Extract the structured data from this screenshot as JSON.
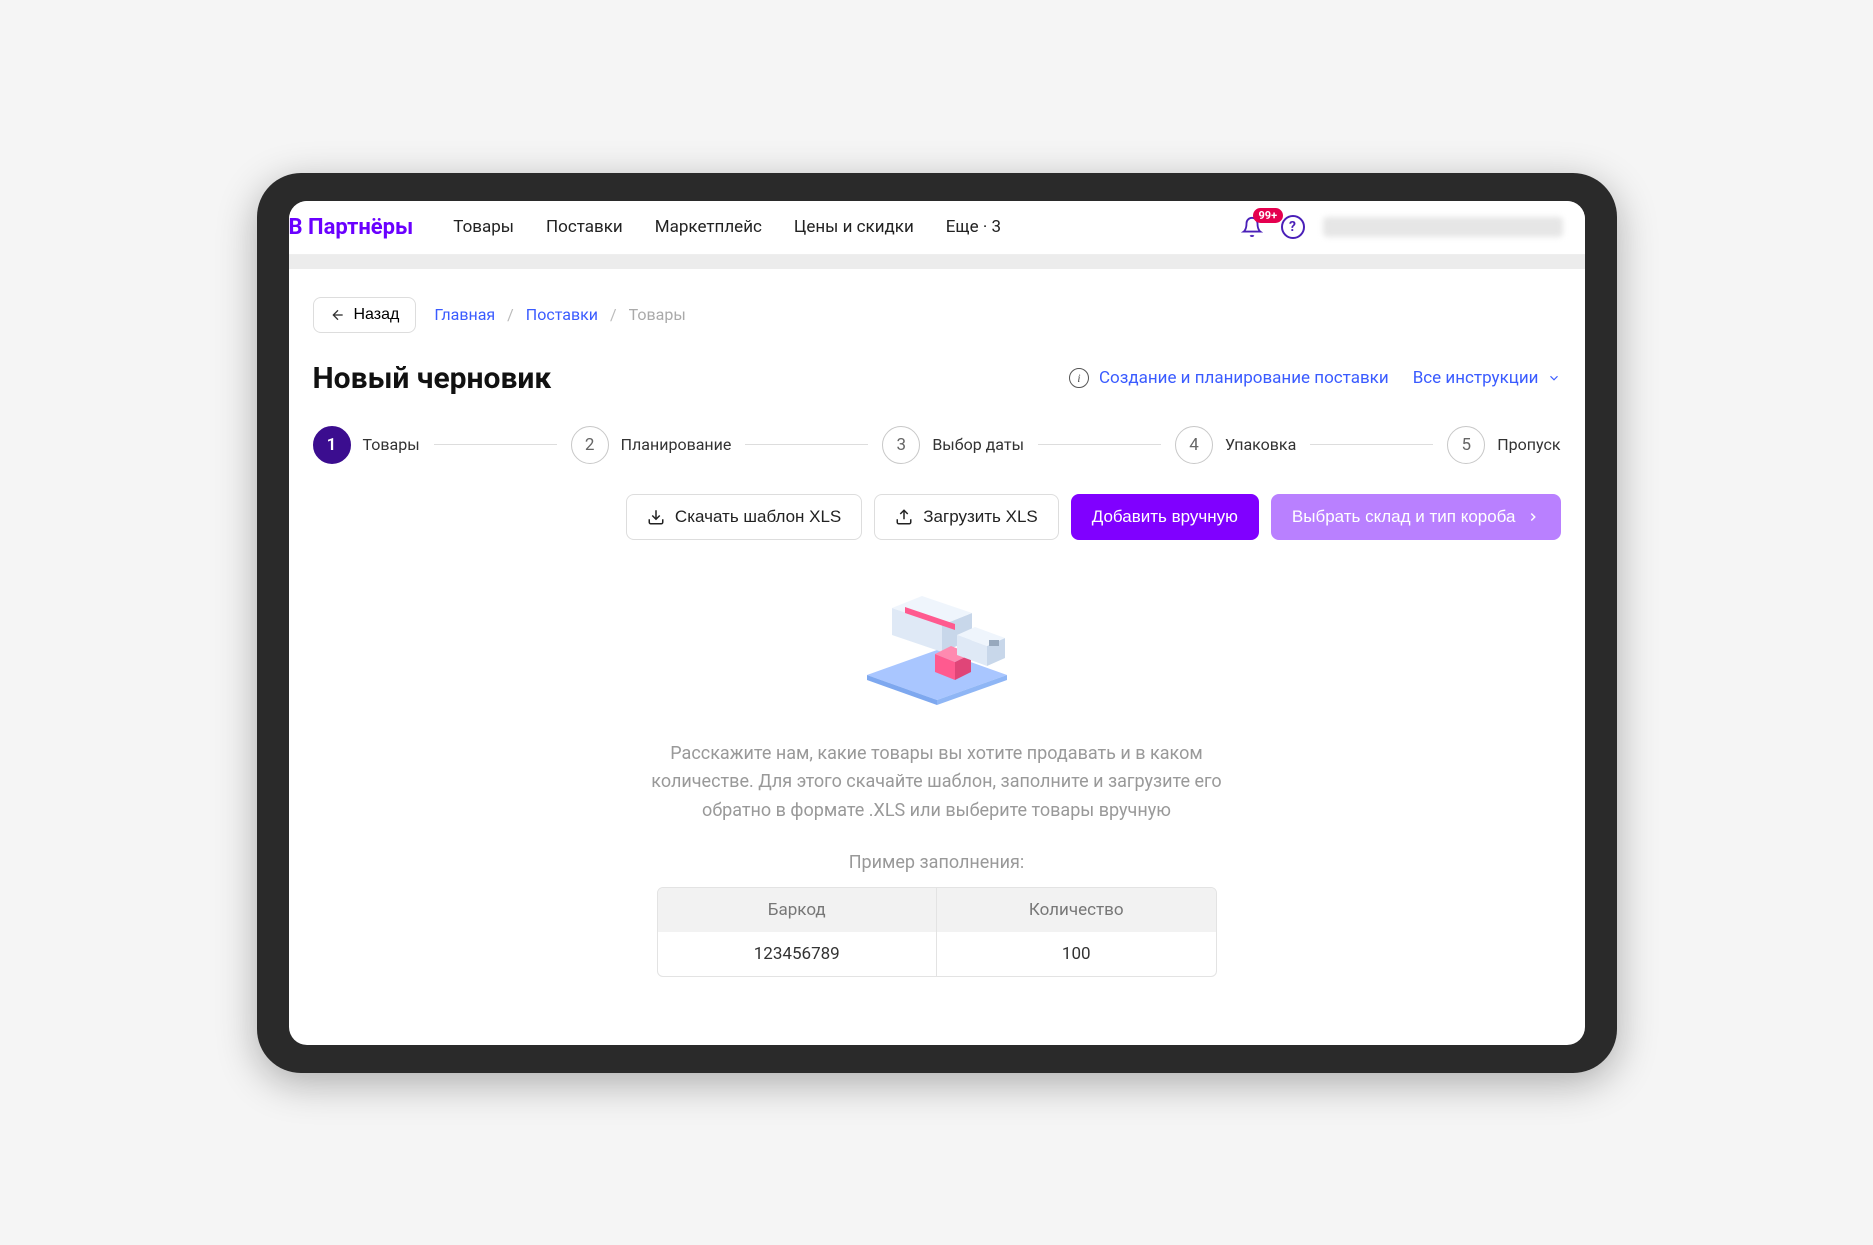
{
  "brand": "В Партнёры",
  "nav": {
    "items": [
      "Товары",
      "Поставки",
      "Маркетплейс",
      "Цены и скидки",
      "Еще · 3"
    ]
  },
  "notification_badge": "99+",
  "back_label": "Назад",
  "breadcrumb": {
    "items": [
      "Главная",
      "Поставки",
      "Товары"
    ]
  },
  "page_title": "Новый черновик",
  "info_link": "Создание и планирование поставки",
  "all_instructions": "Все инструкции",
  "steps": [
    {
      "num": "1",
      "label": "Товары",
      "active": true
    },
    {
      "num": "2",
      "label": "Планирование",
      "active": false
    },
    {
      "num": "3",
      "label": "Выбор даты",
      "active": false
    },
    {
      "num": "4",
      "label": "Упаковка",
      "active": false
    },
    {
      "num": "5",
      "label": "Пропуск",
      "active": false
    }
  ],
  "actions": {
    "download_template": "Скачать шаблон XLS",
    "upload_xls": "Загрузить XLS",
    "add_manual": "Добавить вручную",
    "choose_warehouse": "Выбрать склад и тип короба"
  },
  "empty": {
    "description": "Расскажите нам, какие товары вы хотите продавать и в каком количестве. Для этого скачайте шаблон, заполните и загрузите его обратно в формате .XLS или выберите товары вручную",
    "example_label": "Пример заполнения:",
    "table": {
      "headers": [
        "Баркод",
        "Количество"
      ],
      "row": [
        "123456789",
        "100"
      ]
    }
  }
}
